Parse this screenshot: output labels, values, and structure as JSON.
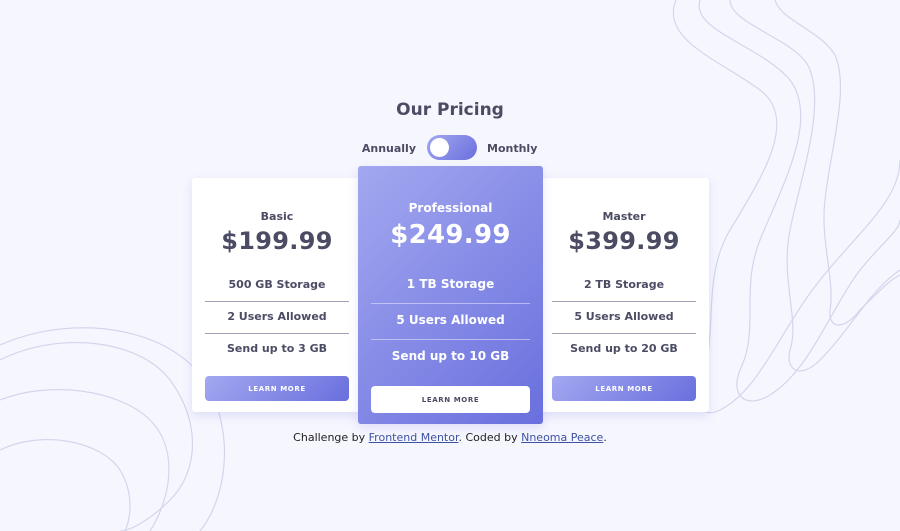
{
  "page": {
    "title": "Our Pricing"
  },
  "toggle": {
    "annually_label": "Annually",
    "monthly_label": "Monthly"
  },
  "plans": [
    {
      "name": "Basic",
      "price": "$199.99",
      "features": [
        "500 GB Storage",
        "2 Users Allowed",
        "Send up to 3 GB"
      ],
      "button": "LEARN MORE"
    },
    {
      "name": "Professional",
      "price": "$249.99",
      "features": [
        "1 TB Storage",
        "5 Users Allowed",
        "Send up to 10 GB"
      ],
      "button": "LEARN MORE"
    },
    {
      "name": "Master",
      "price": "$399.99",
      "features": [
        "2 TB Storage",
        "5 Users Allowed",
        "Send up to 20 GB"
      ],
      "button": "LEARN MORE"
    }
  ],
  "attribution": {
    "prefix": "Challenge by ",
    "link1": "Frontend Mentor",
    "middle": ". Coded by ",
    "link2": "Nneoma Peace",
    "suffix": "."
  },
  "colors": {
    "background": "#f6f6fe",
    "accent_start": "#a3a8f0",
    "accent_end": "#696fdd",
    "text": "#4b4c63"
  }
}
